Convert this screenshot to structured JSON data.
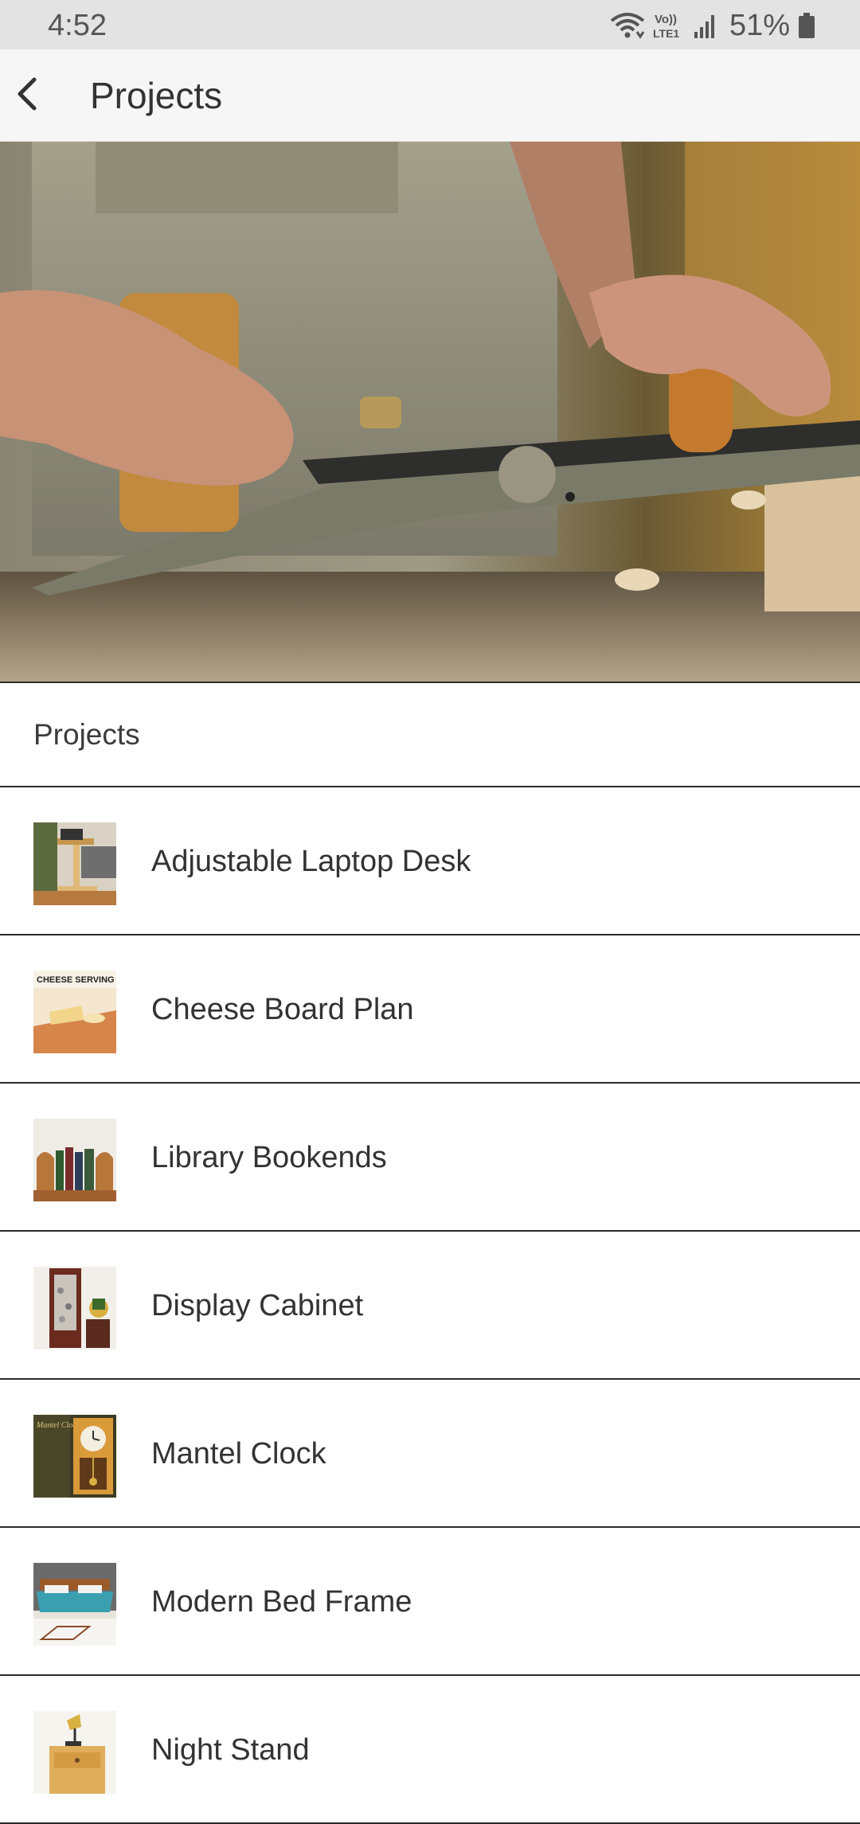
{
  "status_bar": {
    "time": "4:52",
    "battery": "51%",
    "icons": [
      "wifi-icon",
      "volte-icon",
      "signal-icon",
      "battery-icon"
    ],
    "volte_text": "Vo)) LTE1"
  },
  "app_bar": {
    "title": "Projects",
    "back_icon": "chevron-left-icon"
  },
  "hero": {
    "image": "woodworking-hand-plane-photo"
  },
  "section": {
    "title": "Projects"
  },
  "projects": [
    {
      "label": "Adjustable Laptop Desk",
      "thumb": "laptop-desk-photo"
    },
    {
      "label": "Cheese Board Plan",
      "thumb": "cheese-board-photo",
      "thumb_text": "CHEESE SERVING"
    },
    {
      "label": "Library Bookends",
      "thumb": "bookends-photo"
    },
    {
      "label": "Display Cabinet",
      "thumb": "display-cabinet-photo"
    },
    {
      "label": "Mantel Clock",
      "thumb": "mantel-clock-photo",
      "thumb_text": "Mantel Clock"
    },
    {
      "label": "Modern Bed Frame",
      "thumb": "bed-frame-photo"
    },
    {
      "label": "Night Stand",
      "thumb": "night-stand-photo"
    }
  ],
  "colors": {
    "status_bar_bg": "#e3e3e3",
    "app_bar_bg": "#f6f6f6",
    "divider": "#2b2b2b",
    "text": "#333333"
  }
}
